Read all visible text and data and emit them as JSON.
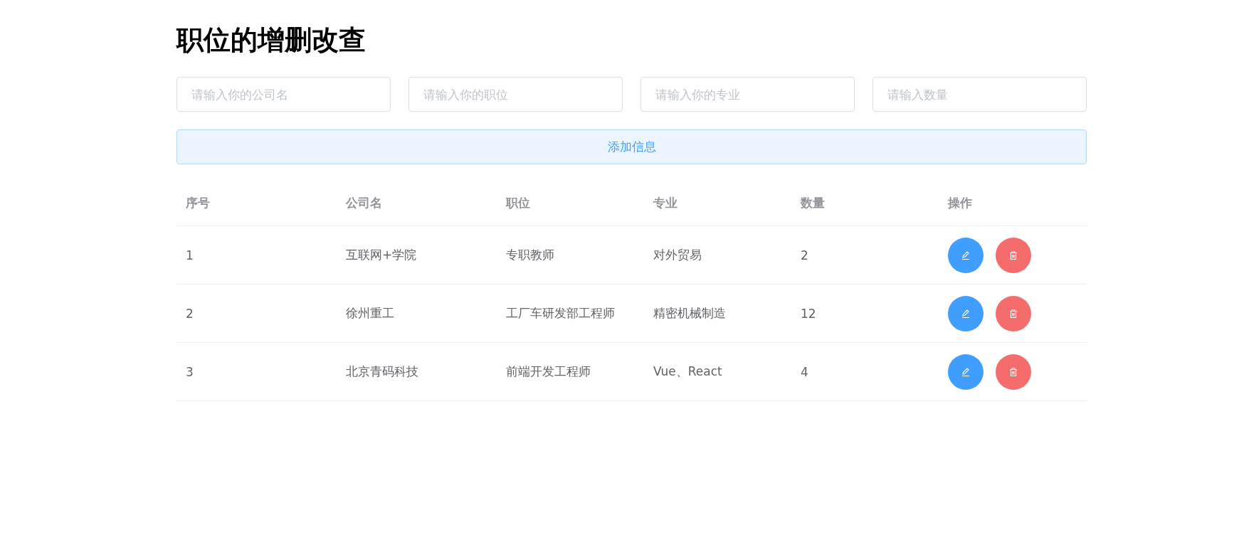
{
  "title": "职位的增删改查",
  "form": {
    "fields": [
      {
        "placeholder": "请输入你的公司名"
      },
      {
        "placeholder": "请输入你的职位"
      },
      {
        "placeholder": "请输入你的专业"
      },
      {
        "placeholder": "请输入数量"
      }
    ],
    "submit": "添加信息"
  },
  "table": {
    "columns": [
      "序号",
      "公司名",
      "职位",
      "专业",
      "数量",
      "操作"
    ],
    "rows": [
      {
        "cells": [
          "1",
          "互联网+学院",
          "专职教师",
          "对外贸易",
          "2"
        ]
      },
      {
        "cells": [
          "2",
          "徐州重工",
          "工厂车研发部工程师",
          "精密机械制造",
          "12"
        ]
      },
      {
        "cells": [
          "3",
          "北京青码科技",
          "前端开发工程师",
          "Vue、React",
          "4"
        ]
      }
    ]
  }
}
